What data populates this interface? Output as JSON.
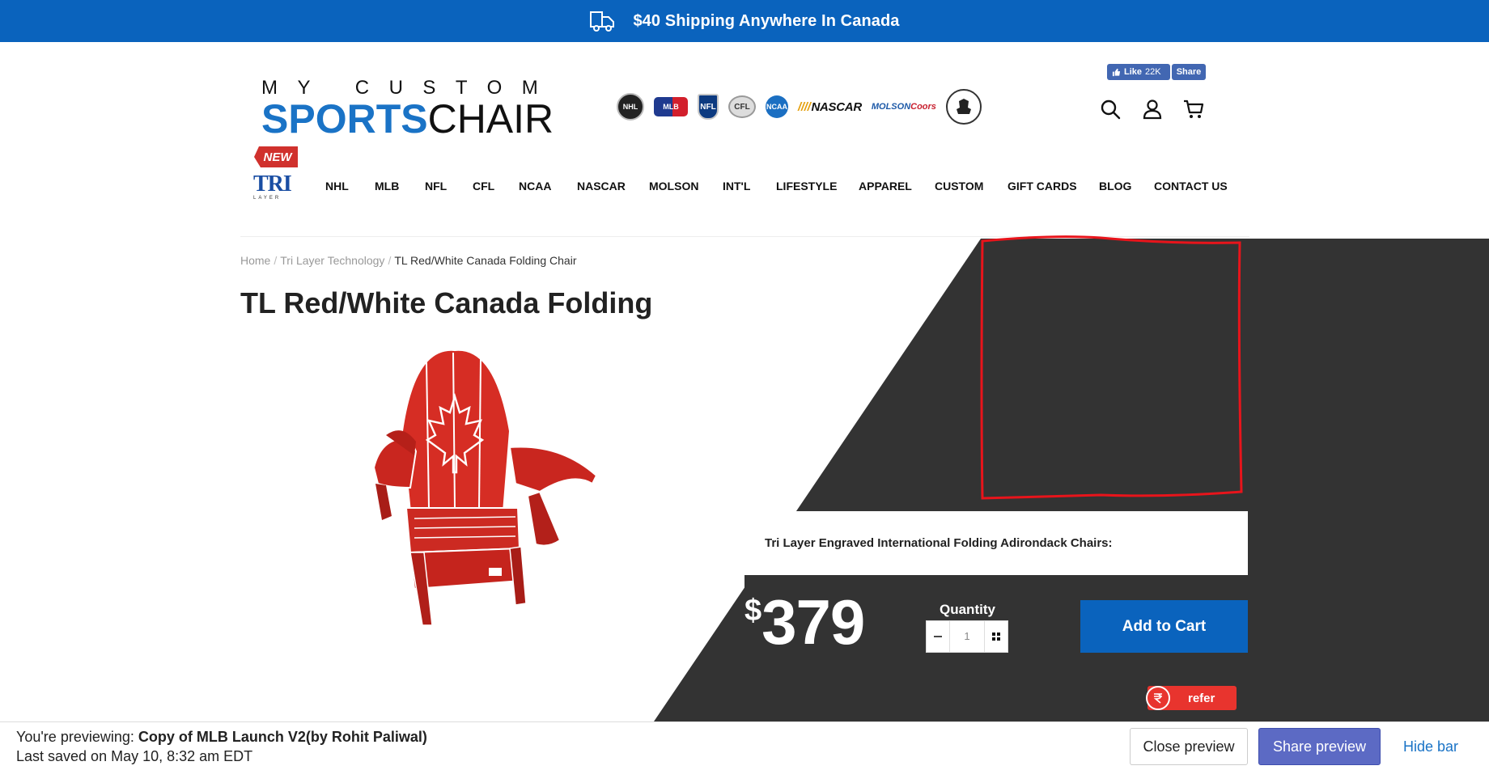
{
  "announcement": {
    "text": "$40 Shipping Anywhere In Canada",
    "icon": "truck-icon"
  },
  "logo": {
    "top": "MY CUSTOM",
    "sports": "SPORTS",
    "chair": "CHAIR"
  },
  "leagues": [
    "NHL",
    "MLB",
    "NFL",
    "CFL",
    "NCAA",
    "NASCAR",
    "MOLSON",
    "Coors"
  ],
  "facebook": {
    "like_label": "Like",
    "like_count": "22K",
    "share_label": "Share"
  },
  "header_icons": [
    "search-icon",
    "user-icon",
    "cart-icon"
  ],
  "nav": {
    "new_badge": "NEW",
    "tri_logo": "TRI",
    "tri_sub": "LAYER",
    "items": [
      "NHL",
      "MLB",
      "NFL",
      "CFL",
      "NCAA",
      "NASCAR",
      "MOLSON",
      "INT'L",
      "LIFESTYLE",
      "APPAREL",
      "CUSTOM",
      "GIFT CARDS",
      "BLOG",
      "CONTACT US"
    ]
  },
  "breadcrumb": {
    "home": "Home",
    "category": "Tri Layer Technology",
    "current": "TL Red/White Canada Folding Chair"
  },
  "product": {
    "title": "TL Red/White Canada Folding",
    "description": "Tri Layer Engraved International Folding Adirondack Chairs:",
    "currency": "$",
    "price": "379",
    "quantity_label": "Quantity",
    "quantity": "1",
    "add_to_cart": "Add to Cart"
  },
  "refer": {
    "label": "refer"
  },
  "preview_bar": {
    "previewing_prefix": "You're previewing:",
    "theme_name": "Copy of MLB Launch V2(by Rohit Paliwal)",
    "last_saved": "Last saved on May 10, 8:32 am EDT",
    "close": "Close preview",
    "share": "Share preview",
    "hide": "Hide bar"
  },
  "colors": {
    "brand_blue": "#0a63bd",
    "dark_panel": "#333333",
    "annotation_red": "#e8141b",
    "refer_red": "#e8342e",
    "share_purple": "#5c6ac4"
  }
}
